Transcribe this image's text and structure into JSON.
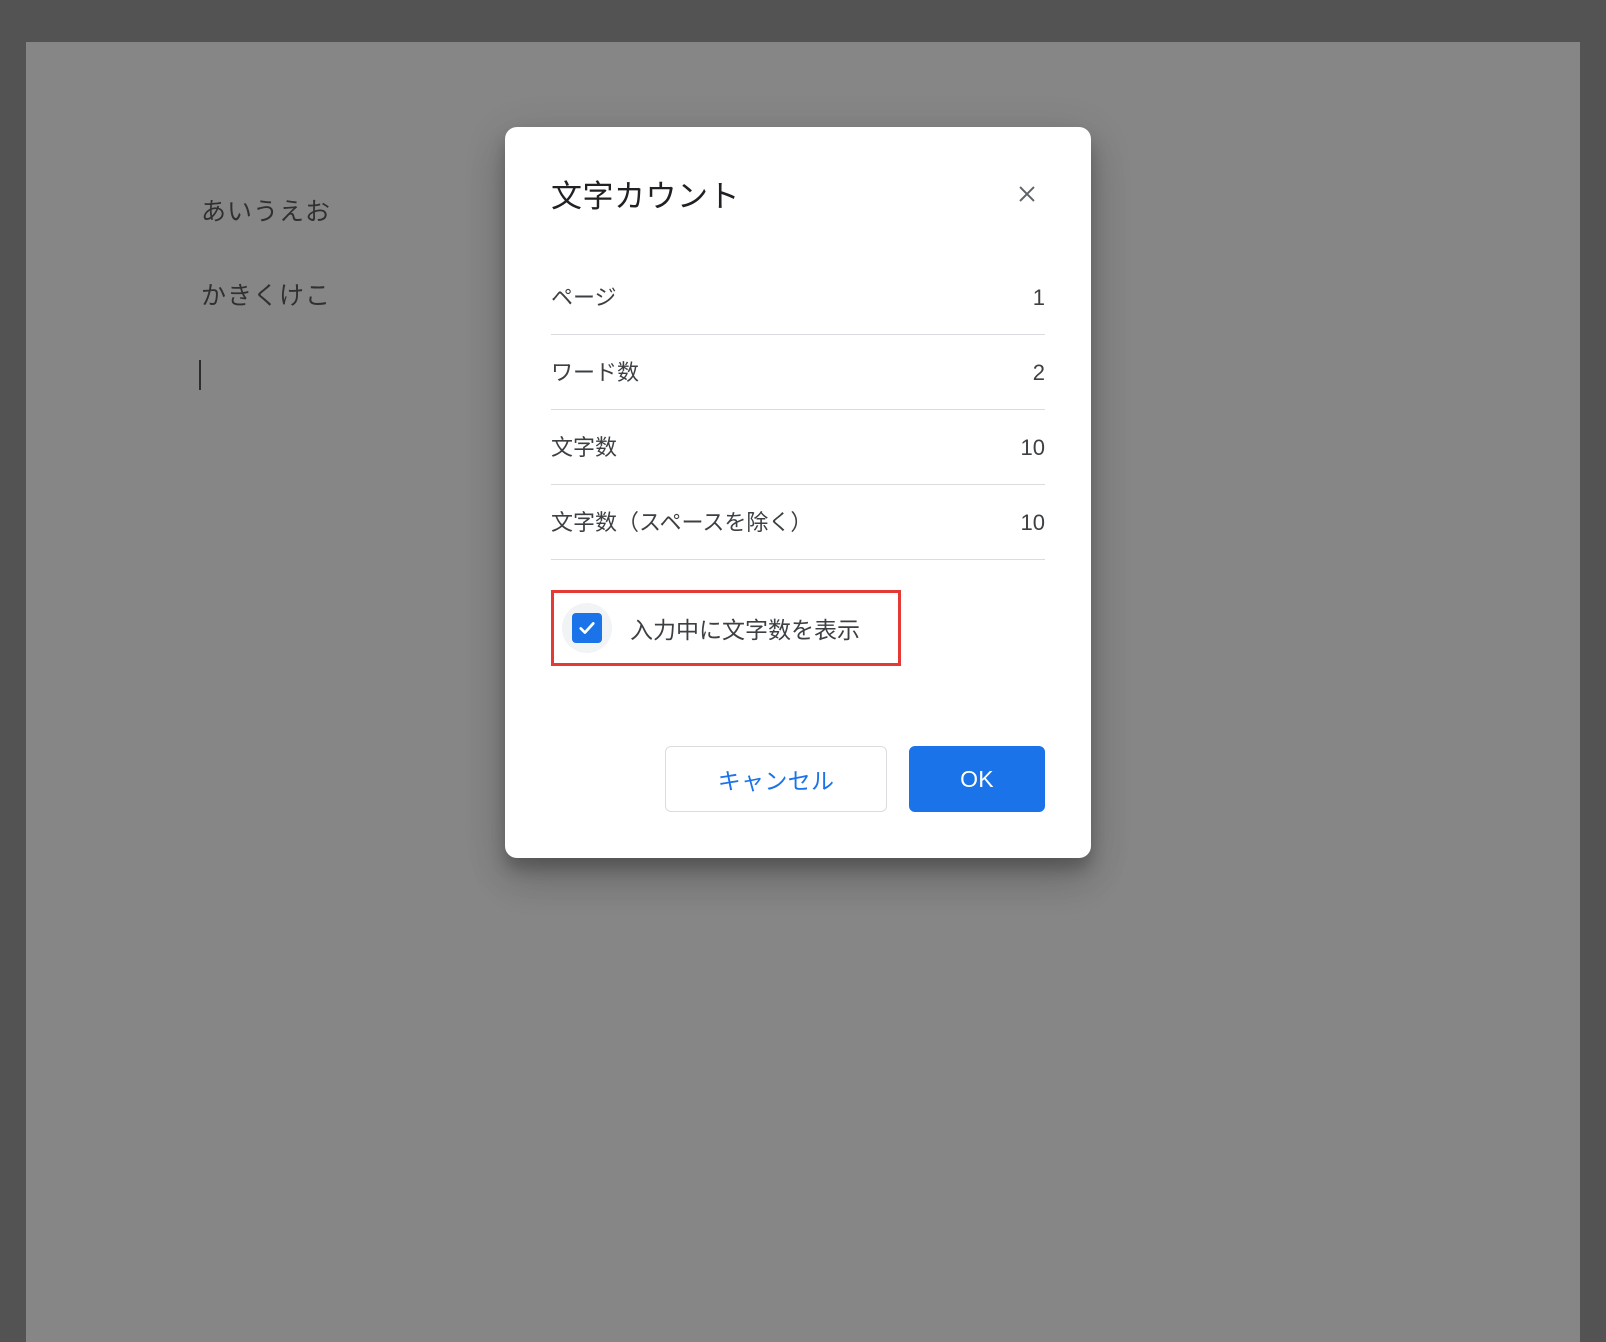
{
  "document": {
    "lines": [
      "あいうえお",
      "かきくけこ"
    ]
  },
  "dialog": {
    "title": "文字カウント",
    "stats": [
      {
        "label": "ページ",
        "value": "1"
      },
      {
        "label": "ワード数",
        "value": "2"
      },
      {
        "label": "文字数",
        "value": "10"
      },
      {
        "label": "文字数（スペースを除く）",
        "value": "10"
      }
    ],
    "checkbox": {
      "label": "入力中に文字数を表示",
      "checked": true
    },
    "buttons": {
      "cancel": "キャンセル",
      "ok": "OK"
    }
  }
}
